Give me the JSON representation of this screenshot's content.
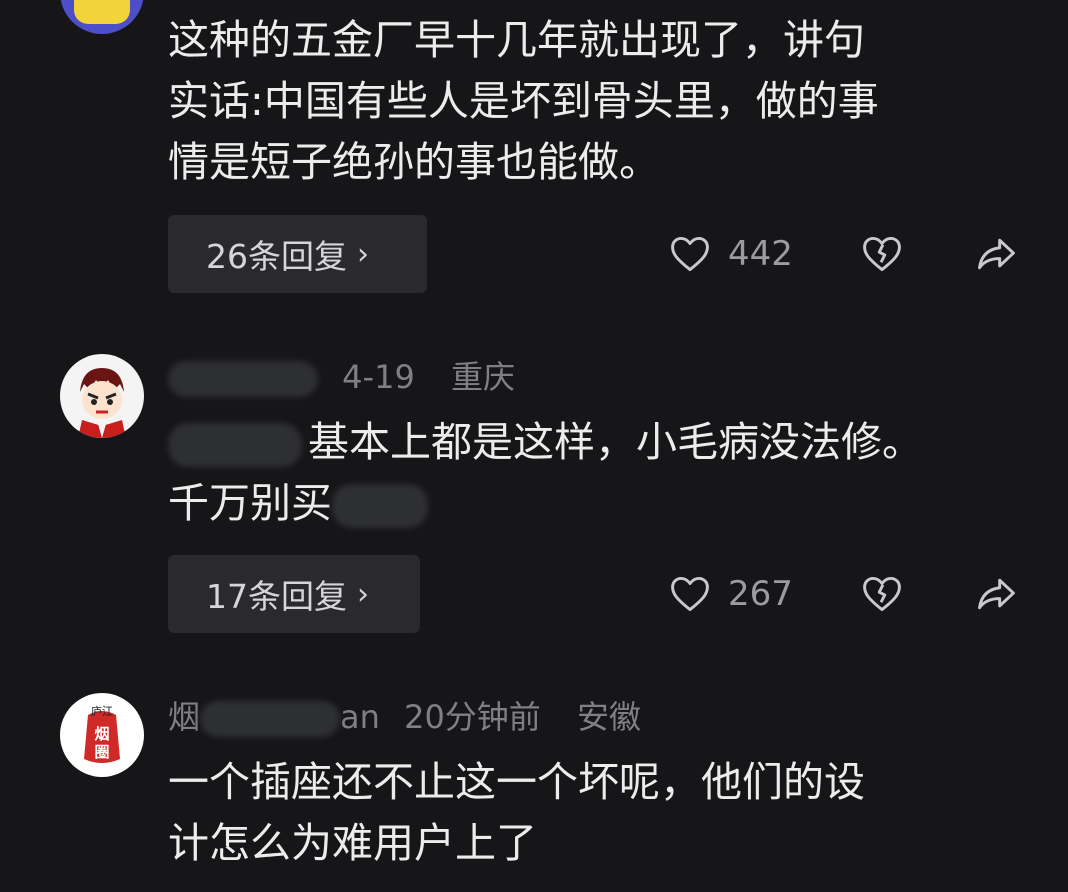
{
  "comments": [
    {
      "avatar": "yellow-emoji-avatar",
      "text_lines": [
        "这种的五金厂早十几年就出现了，讲句",
        "实话:中国有些人是坏到骨头里，做的事",
        "情是短子绝孙的事也能做。"
      ],
      "reply_label": "26条回复",
      "likes": "442"
    },
    {
      "avatar": "cartoon-face-avatar",
      "time": "4-19",
      "location": "重庆",
      "text_lines": [
        "基本上都是这样，小毛病没法修。",
        "千万别买"
      ],
      "reply_label": "17条回复",
      "likes": "267"
    },
    {
      "avatar": "red-seal-avatar",
      "avatar_text": [
        "庐江",
        "烟圈"
      ],
      "name_prefix": "烟",
      "name_suffix": "an",
      "time": "20分钟前",
      "location": "安徽",
      "text_lines": [
        "一个插座还不止这一个坏呢，他们的设",
        "计怎么为难用户上了"
      ]
    }
  ],
  "icons": {
    "like": "heart-outline-icon",
    "dislike": "broken-heart-icon",
    "share": "share-arrow-icon",
    "chevron": "chevron-right-icon"
  },
  "colors": {
    "background": "#161618",
    "text": "#ececec",
    "meta": "#7f7f84",
    "reply_button": "#2a2a2c"
  }
}
